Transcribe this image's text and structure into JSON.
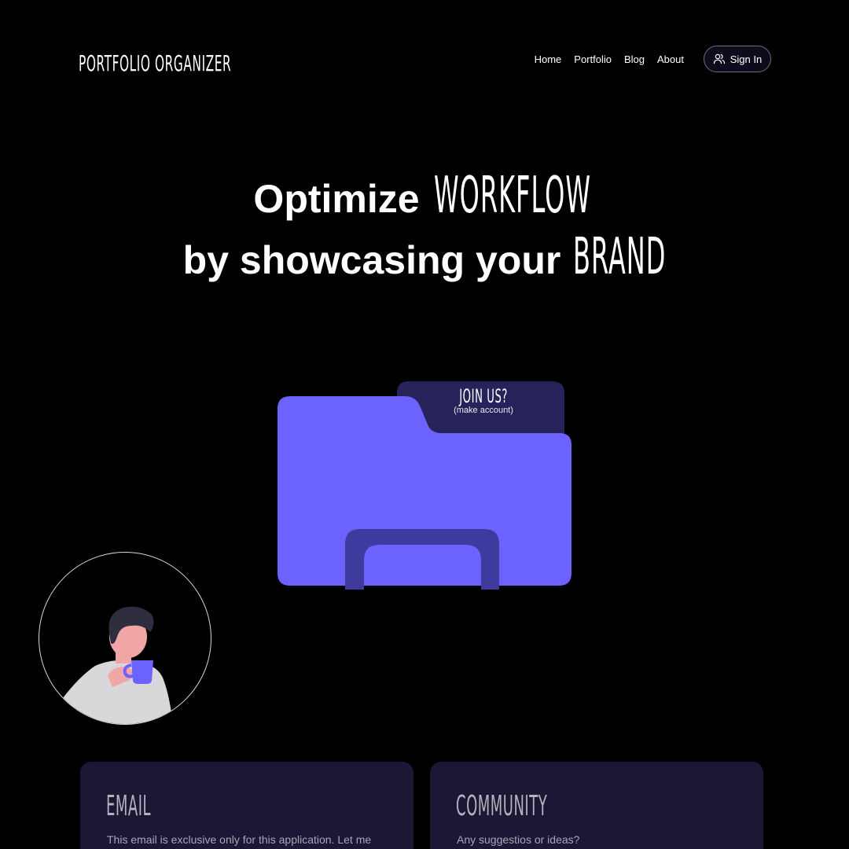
{
  "header": {
    "brand": "PORTFOLIO ORGANIZER",
    "nav": [
      {
        "label": "Home"
      },
      {
        "label": "Portfolio"
      },
      {
        "label": "Blog"
      },
      {
        "label": "About"
      }
    ],
    "signin_label": "Sign In",
    "signin_icon": "users-icon"
  },
  "hero": {
    "line1_text": "Optimize",
    "line1_highlight": "WORKFLOW",
    "line2_text": "by showcasing your",
    "line2_highlight": "BRAND"
  },
  "folder": {
    "title": "JOIN US?",
    "subtitle": "(make account)",
    "colors": {
      "body": "#6c63ff",
      "tab": "#26235a",
      "handle": "#3f3a9e"
    }
  },
  "cards": {
    "email": {
      "title": "EMAIL",
      "text": "This email is exclusive only for this application. Let me"
    },
    "community": {
      "title": "COMMUNITY",
      "text": "Any suggestios or ideas?"
    }
  },
  "colors": {
    "background": "#000000",
    "card": "#1a1835",
    "accent": "#6c63ff"
  }
}
